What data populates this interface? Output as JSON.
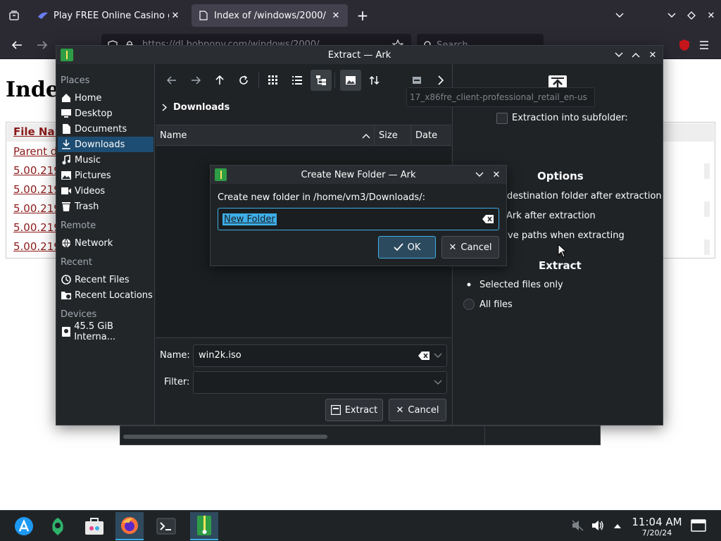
{
  "browser": {
    "tabs": [
      {
        "title": "Play FREE Online Casino g"
      },
      {
        "title": "Index of /windows/2000/"
      }
    ],
    "url": "https://dl.bobpony.com/windows/2000/",
    "search_placeholder": "Search"
  },
  "webpage": {
    "heading": "Inde",
    "col_header": "File Nar",
    "links": [
      "Parent d",
      "5.00.219",
      "5.00.219",
      "5.00.219",
      "5.00.219",
      "5.00.219"
    ]
  },
  "ark": {
    "title": "Extract — Ark",
    "places": {
      "sections": {
        "places": "Places",
        "remote": "Remote",
        "recent": "Recent",
        "devices": "Devices"
      },
      "items": {
        "home": "Home",
        "desktop": "Desktop",
        "documents": "Documents",
        "downloads": "Downloads",
        "music": "Music",
        "pictures": "Pictures",
        "videos": "Videos",
        "trash": "Trash",
        "network": "Network",
        "recent_files": "Recent Files",
        "recent_locations": "Recent Locations",
        "device": "45.5 GiB Interna..."
      }
    },
    "breadcrumb": "Downloads",
    "columns": {
      "name": "Name",
      "size": "Size",
      "date": "Date"
    },
    "name_label": "Name:",
    "name_value": "win2k.iso",
    "filter_label": "Filter:",
    "extract_button": "Extract",
    "cancel_button": "Cancel",
    "options": {
      "subfolder_label": "Extraction into subfolder:",
      "subfolder_value": "17_x86fre_client-professional_retail_en-us",
      "options_heading": "Options",
      "opt1": "destination folder after extraction",
      "opt2": "Ark after extraction",
      "opt3": "ve paths when extracting",
      "extract_heading": "Extract",
      "radio_selected": "Selected files only",
      "radio_all": "All files"
    }
  },
  "dialog": {
    "title": "Create New Folder — Ark",
    "prompt": "Create new folder in /home/vm3/Downloads/:",
    "input_value": "New Folder",
    "ok": "OK",
    "cancel": "Cancel"
  },
  "taskbar": {
    "time": "11:04 AM",
    "date": "7/20/24"
  },
  "colors": {
    "accent": "#3daee9",
    "selection": "#1d4d73",
    "ark_bg": "#202326"
  }
}
